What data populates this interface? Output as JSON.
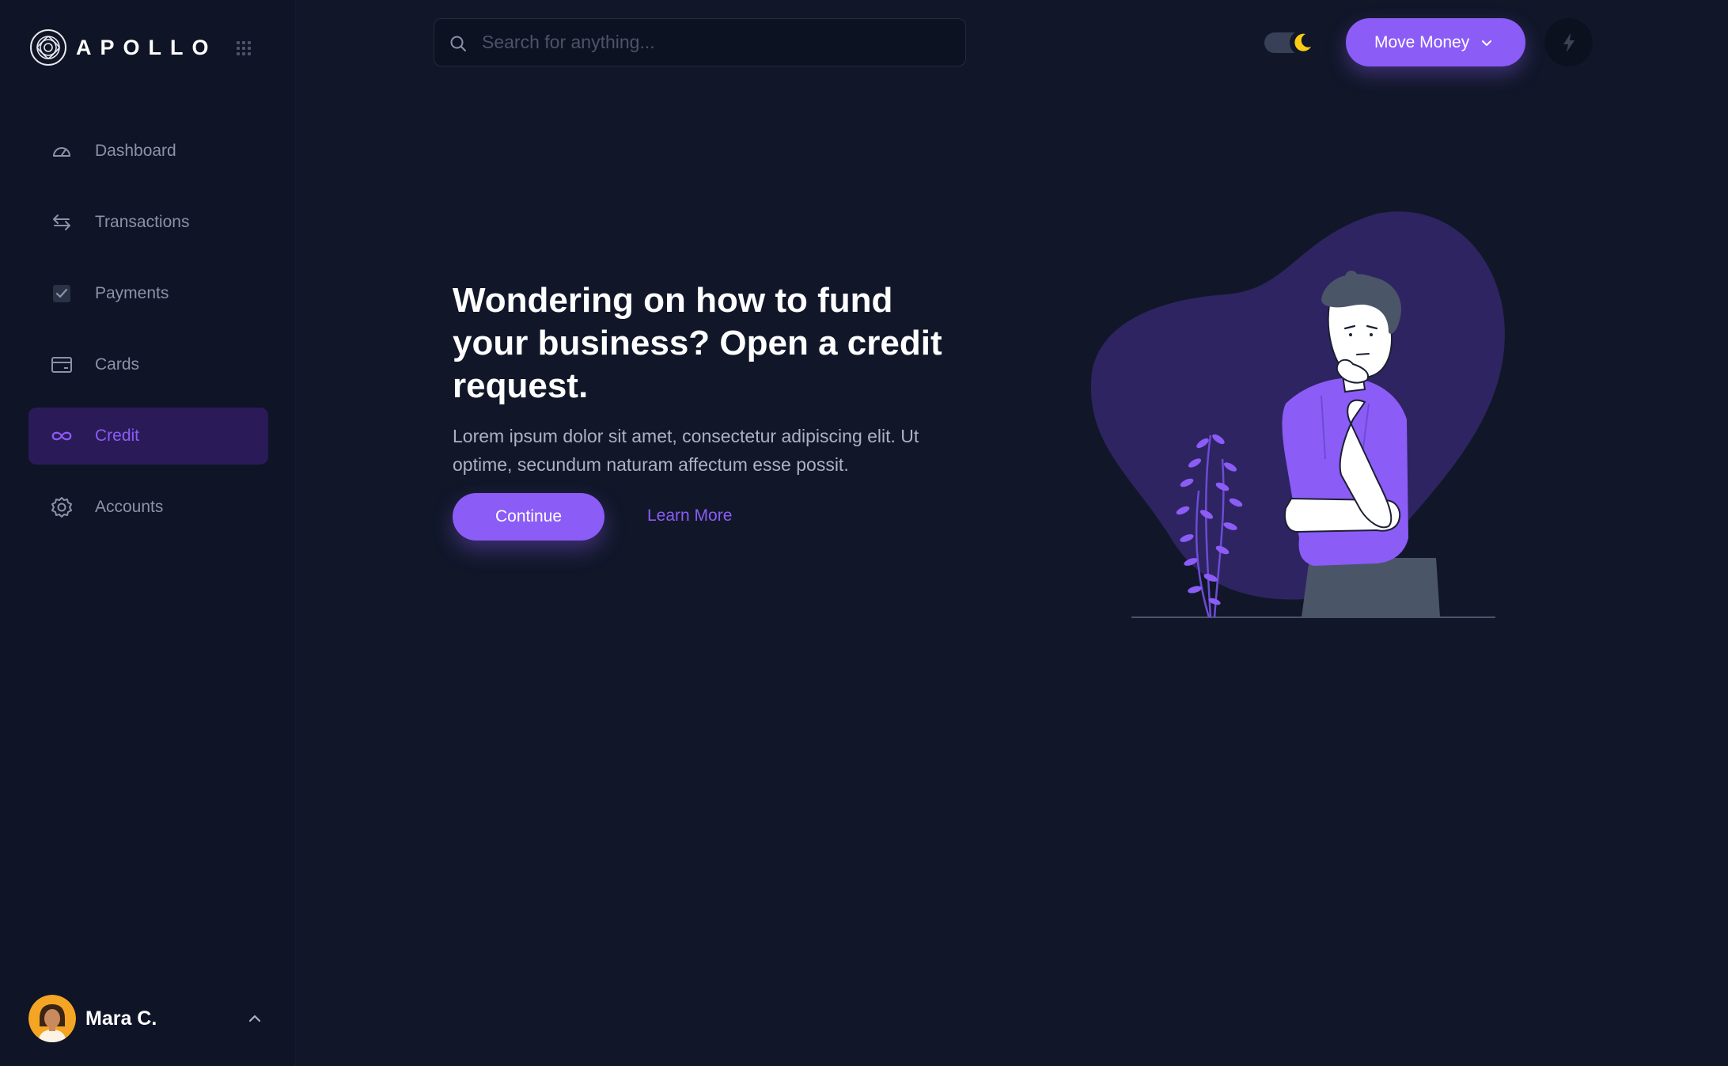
{
  "brand": {
    "name": "APOLLO"
  },
  "sidebar": {
    "items": [
      {
        "label": "Dashboard",
        "icon": "speedometer-icon",
        "active": false
      },
      {
        "label": "Transactions",
        "icon": "transfer-arrows-icon",
        "active": false
      },
      {
        "label": "Payments",
        "icon": "checkbox-icon",
        "active": false
      },
      {
        "label": "Cards",
        "icon": "credit-card-icon",
        "active": false
      },
      {
        "label": "Credit",
        "icon": "infinity-icon",
        "active": true
      },
      {
        "label": "Accounts",
        "icon": "gear-icon",
        "active": false
      }
    ]
  },
  "user": {
    "name": "Mara C."
  },
  "search": {
    "placeholder": "Search for anything..."
  },
  "header": {
    "move_money_label": "Move Money",
    "theme": "dark"
  },
  "hero": {
    "title": "Wondering on how to fund your business? Open a credit request.",
    "body": "Lorem ipsum dolor sit amet, consectetur adipiscing elit. Ut optime, secundum naturam affectum esse possit.",
    "primary_cta": "Continue",
    "secondary_cta": "Learn More"
  },
  "colors": {
    "background": "#111729",
    "sidebar": "#0f1426",
    "accent": "#8b5cf6",
    "active_nav_bg": "#2a1b58",
    "moon": "#facc15"
  }
}
